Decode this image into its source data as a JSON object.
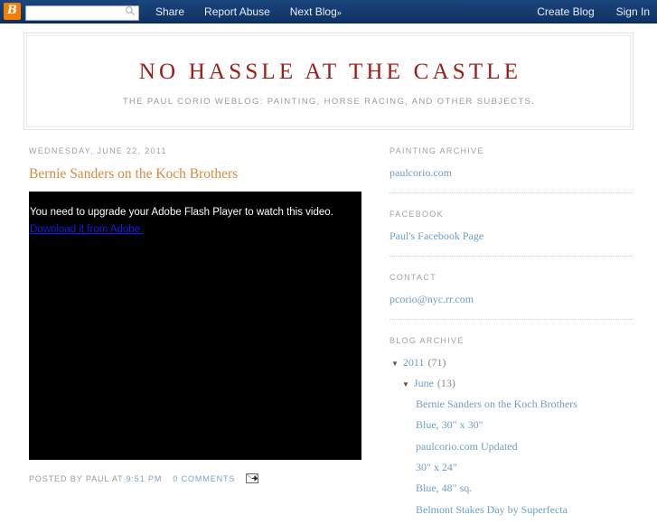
{
  "navbar": {
    "logo_letter": "B",
    "search_placeholder": "",
    "search_value": "",
    "search_icon": "search-icon",
    "links": [
      {
        "label": "Share"
      },
      {
        "label": "Report Abuse"
      },
      {
        "label": "Next Blog",
        "suffix": "»"
      }
    ],
    "right_links": [
      {
        "label": "Create Blog"
      },
      {
        "label": "Sign In"
      }
    ]
  },
  "header": {
    "title": "NO HASSLE AT THE CASTLE",
    "description": "THE PAUL CORIO WEBLOG: PAINTING, HORSE RACING, AND OTHER SUBJECTS."
  },
  "post": {
    "date": "WEDNESDAY, JUNE 22, 2011",
    "title": "Bernie Sanders on the Koch Brothers",
    "flash_message": "You need to upgrade your Adobe Flash Player to watch this video.",
    "flash_link": "Download it from Adobe.",
    "footer": {
      "posted_by": "POSTED BY PAUL AT",
      "time": "9:51 PM",
      "comments": "0 COMMENTS",
      "email_icon": "email-post-icon"
    }
  },
  "sidebar": {
    "sections": [
      {
        "title": "PAINTING ARCHIVE",
        "links": [
          {
            "label": "paulcorio.com"
          }
        ]
      },
      {
        "title": "FACEBOOK",
        "links": [
          {
            "label": "Paul's Facebook Page"
          }
        ]
      },
      {
        "title": "CONTACT",
        "links": [
          {
            "label": "pcorio@nyc.rr.com"
          }
        ]
      }
    ],
    "archive": {
      "title": "BLOG ARCHIVE",
      "year": {
        "toggle": "▼",
        "label": "2011",
        "count": "(71)"
      },
      "month": {
        "toggle": "▼",
        "label": "June",
        "count": "(13)"
      },
      "posts": [
        {
          "label": "Bernie Sanders on the Koch Brothers"
        },
        {
          "label": "Blue, 30\" x 30\""
        },
        {
          "label": "paulcorio.com Updated"
        },
        {
          "label": "30\" x 24\""
        },
        {
          "label": "Blue, 48\" sq."
        },
        {
          "label": "Belmont Stakes Day by Superfecta"
        }
      ]
    }
  },
  "colors": {
    "navbar_bg": "#13386b",
    "brand_orange": "#f57d00",
    "title_red": "#9e1b14",
    "post_title_orange": "#d78a3c",
    "link_blue": "#6f9ec4",
    "flash_link_blue": "#1b17ee"
  }
}
